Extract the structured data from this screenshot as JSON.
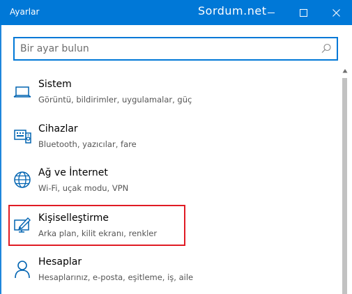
{
  "window": {
    "title": "Ayarlar",
    "watermark": "Sordum.net",
    "accent_color": "#0078d7"
  },
  "controls": {
    "minimize_icon": "minimize-icon",
    "maximize_icon": "maximize-icon",
    "close_icon": "close-icon"
  },
  "search": {
    "placeholder": "Bir ayar bulun",
    "value": "",
    "icon": "search-icon"
  },
  "items": [
    {
      "label": "Sistem",
      "desc": "Görüntü, bildirimler, uygulamalar, güç",
      "icon": "laptop-icon"
    },
    {
      "label": "Cihazlar",
      "desc": "Bluetooth, yazıcılar, fare",
      "icon": "devices-icon"
    },
    {
      "label": "Ağ ve İnternet",
      "desc": "Wi-Fi, uçak modu, VPN",
      "icon": "globe-icon"
    },
    {
      "label": "Kişiselleştirme",
      "desc": "Arka plan, kilit ekranı, renkler",
      "icon": "personalization-icon",
      "highlighted": true
    },
    {
      "label": "Hesaplar",
      "desc": "Hesaplarınız, e-posta, eşitleme, iş, aile",
      "icon": "person-icon"
    }
  ]
}
